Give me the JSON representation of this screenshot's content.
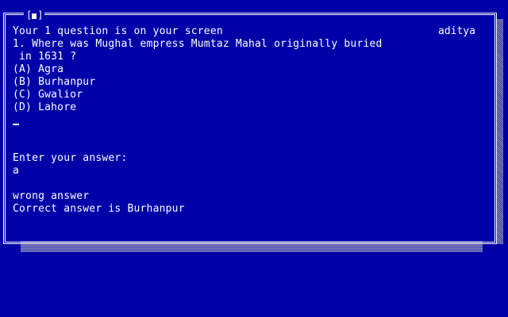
{
  "window": {
    "close_glyph": "■"
  },
  "header": {
    "status": "Your 1 question is on your screen",
    "user": "aditya"
  },
  "question": {
    "line1": "1. Where was Mughal empress Mumtaz Mahal originally buried",
    "line2": " in 1631 ?"
  },
  "options": [
    "(A) Agra",
    "(B) Burhanpur",
    "(C) Gwalior",
    "(D) Lahore"
  ],
  "prompt": {
    "label": "Enter your answer:",
    "value": "a"
  },
  "result": {
    "verdict": "wrong answer",
    "correct": "Correct answer is Burhanpur"
  },
  "colors": {
    "background": "#0000a8",
    "text": "#ffffff"
  }
}
